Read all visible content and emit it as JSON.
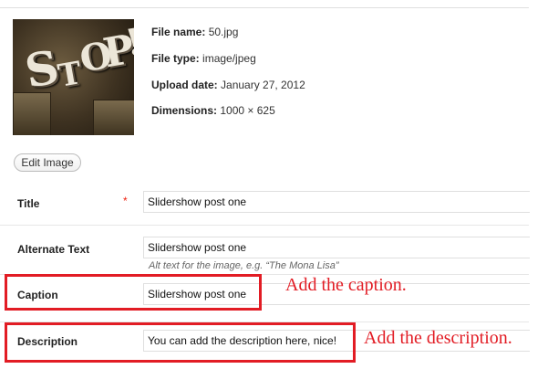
{
  "image_details": {
    "thumbnail_alt": "STOP letterpress blocks",
    "thumbnail_letters": [
      "S",
      "T",
      "O",
      "P",
      "!"
    ],
    "file_name_label": "File name:",
    "file_name": "50.jpg",
    "file_type_label": "File type:",
    "file_type": "image/jpeg",
    "upload_date_label": "Upload date:",
    "upload_date": "January 27, 2012",
    "dimensions_label": "Dimensions:",
    "dimensions": "1000 × 625"
  },
  "edit_image_button": "Edit Image",
  "form": {
    "title_label": "Title",
    "required_mark": "*",
    "title_value": "Slidershow post one",
    "alt_label": "Alternate Text",
    "alt_value": "Slidershow post one",
    "alt_hint": "Alt text for the image, e.g. “The Mona Lisa”",
    "caption_label": "Caption",
    "caption_value": "Slidershow post one",
    "description_label": "Description",
    "description_value": "You can add the description here, nice!"
  },
  "annotations": {
    "caption_note": "Add the caption.",
    "description_note": "Add the description."
  },
  "colors": {
    "annotation_red": "#e21c24",
    "required_red": "#ee2211"
  }
}
